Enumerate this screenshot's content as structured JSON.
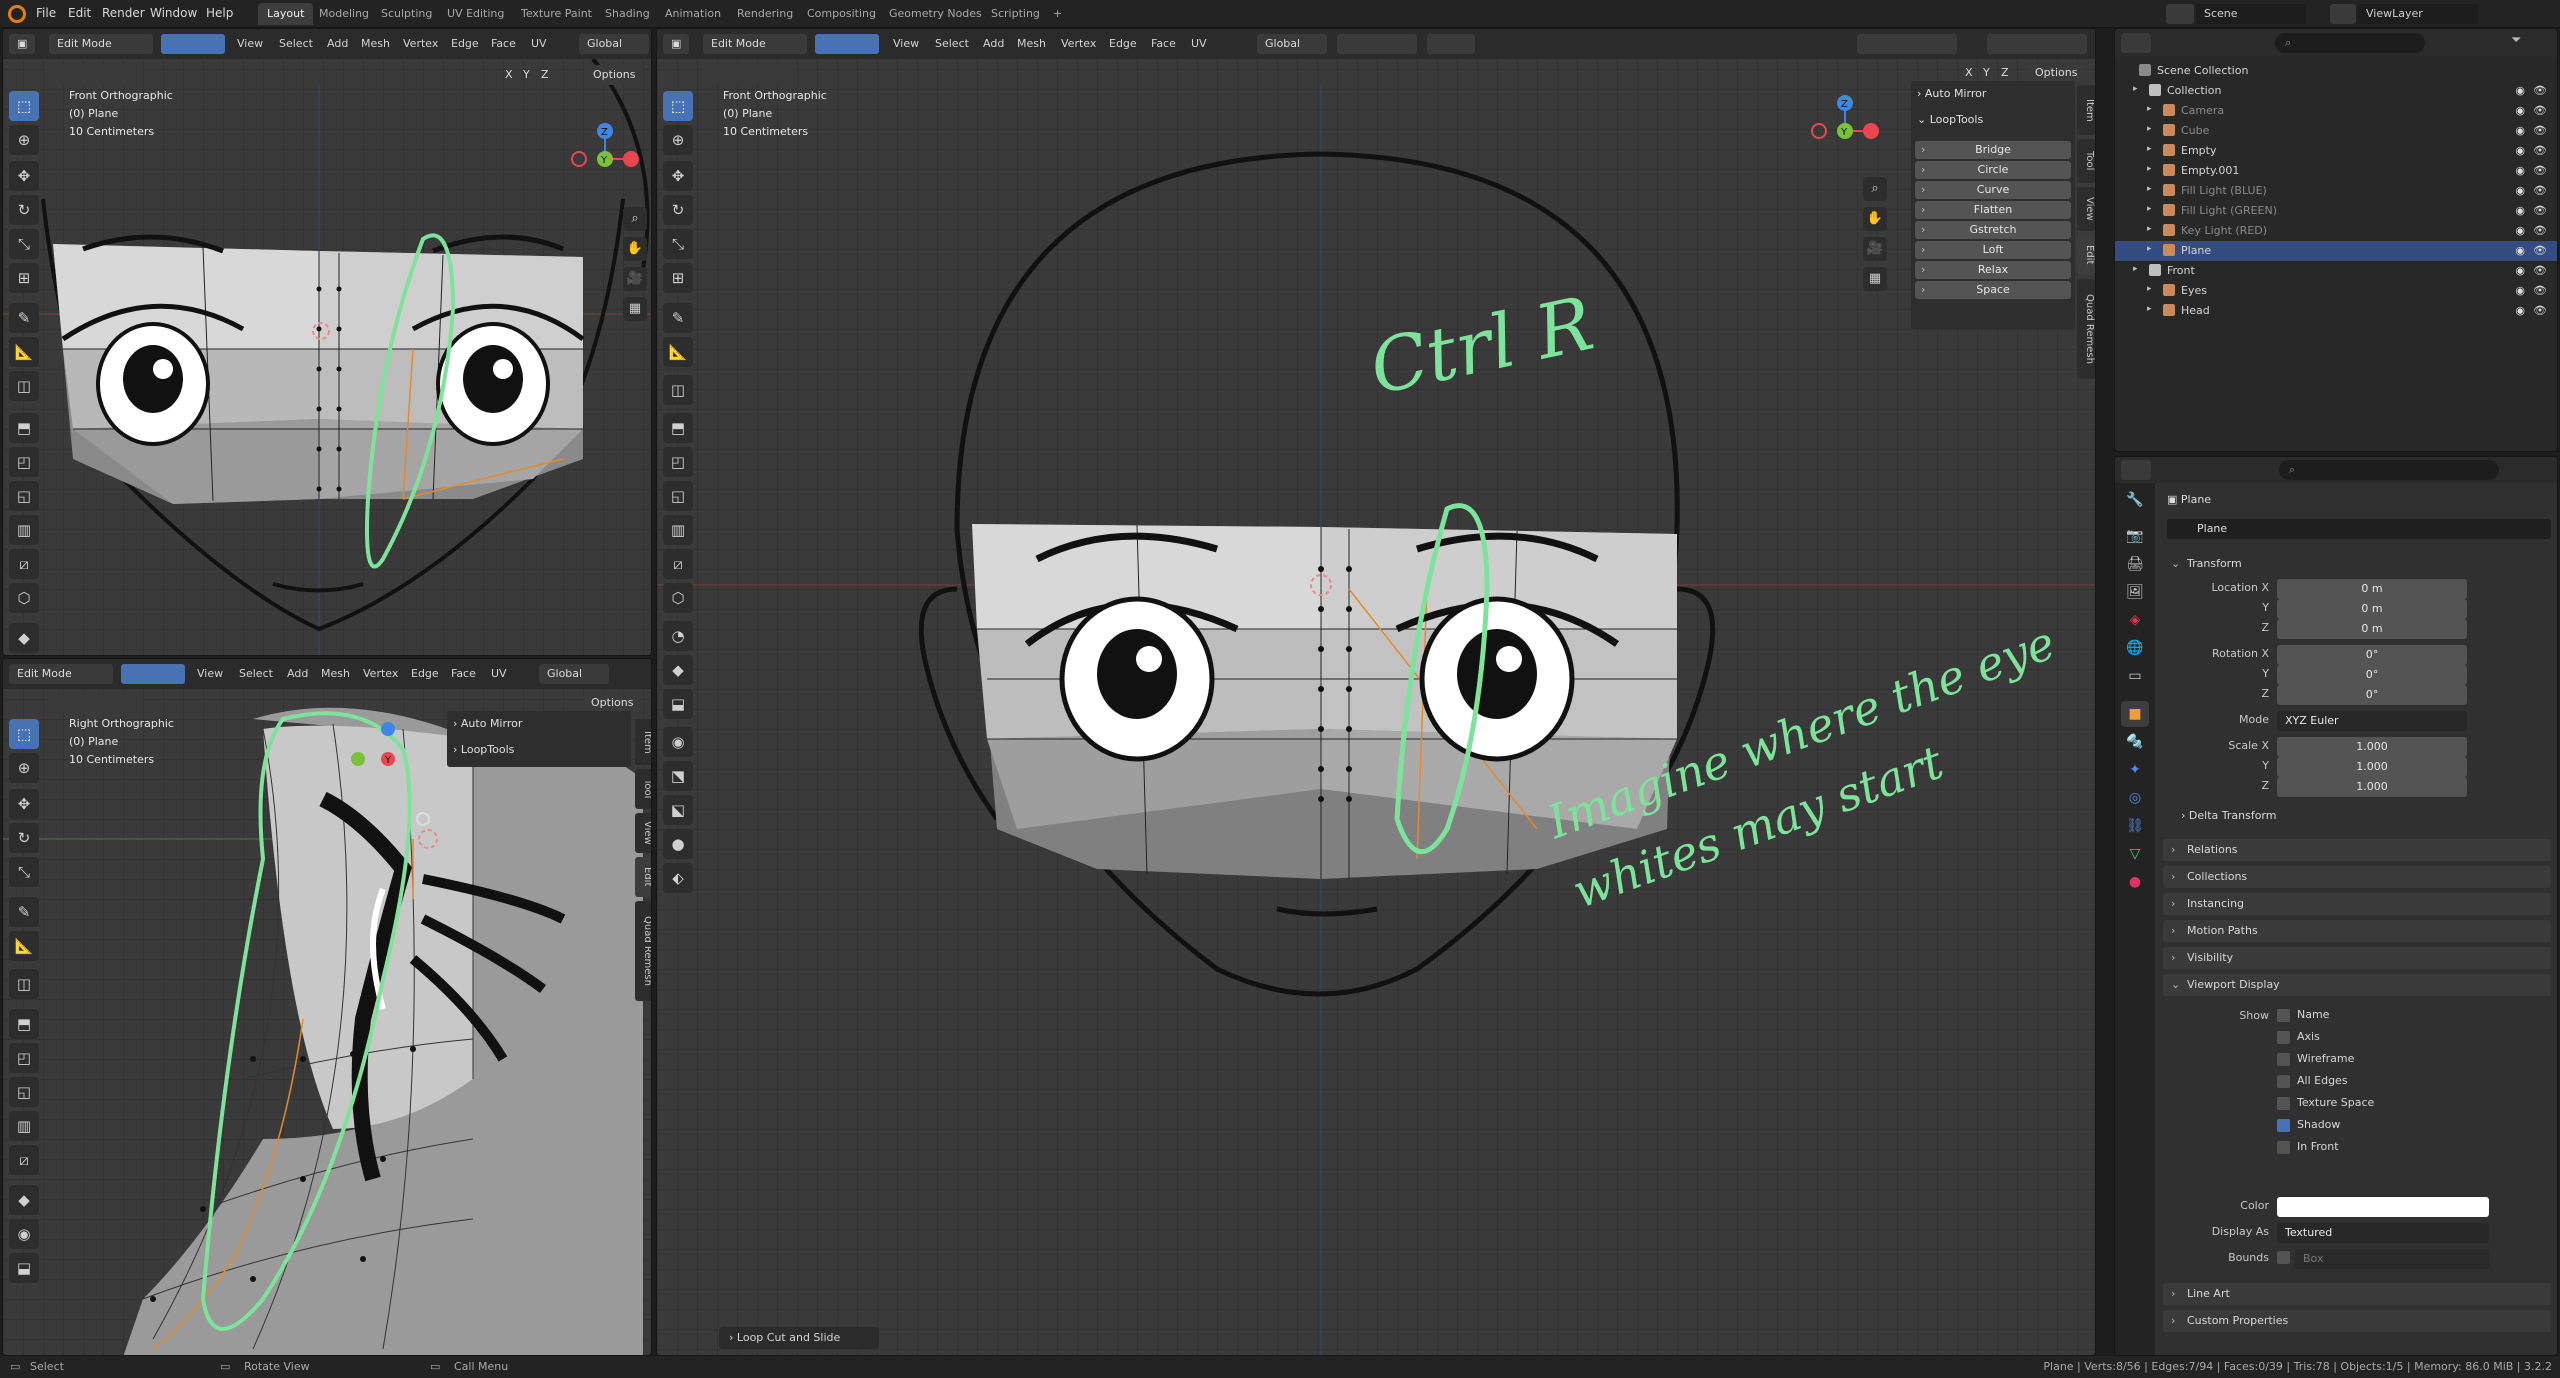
{
  "menu": [
    "File",
    "Edit",
    "Render",
    "Window",
    "Help"
  ],
  "workspaces": {
    "active": "Layout",
    "tabs": [
      "Layout",
      "Modeling",
      "Sculpting",
      "UV Editing",
      "Texture Paint",
      "Shading",
      "Animation",
      "Rendering",
      "Compositing",
      "Geometry Nodes",
      "Scripting"
    ],
    "add": "+"
  },
  "top_right": {
    "scene": "Scene",
    "view_layer": "ViewLayer"
  },
  "vp_header": {
    "mode": "Edit Mode",
    "view": "View",
    "select": "Select",
    "add": "Add",
    "mesh": "Mesh",
    "vertex": "Vertex",
    "edge": "Edge",
    "face": "Face",
    "uv": "UV",
    "orientation": "Global",
    "options": "Options",
    "axes": [
      "X",
      "Y",
      "Z"
    ]
  },
  "viewport_tl": {
    "title": "Front Orthographic",
    "object": "(0) Plane",
    "scale": "10 Centimeters"
  },
  "viewport_bl": {
    "title": "Right Orthographic",
    "object": "(0) Plane",
    "scale": "10 Centimeters",
    "panel": {
      "auto_mirror": "Auto Mirror",
      "looptools": "LoopTools"
    }
  },
  "viewport_main": {
    "title": "Front Orthographic",
    "object": "(0) Plane",
    "scale": "10 Centimeters",
    "last_op": "Loop Cut and Slide"
  },
  "npanel_main": {
    "auto_mirror": "Auto Mirror",
    "looptools": "LoopTools",
    "buttons": [
      "Bridge",
      "Circle",
      "Curve",
      "Flatten",
      "Gstretch",
      "Loft",
      "Relax",
      "Space"
    ]
  },
  "side_tabs": [
    "Item",
    "Tool",
    "View",
    "Edit",
    "Quad Remesh"
  ],
  "gizmo": {
    "x": "X",
    "y": "Y",
    "z": "Z"
  },
  "handwriting": {
    "shortcut": "Ctrl R",
    "note": "Imagine where the eye whites may start"
  },
  "outliner": {
    "root": "Scene Collection",
    "rows": [
      {
        "label": "Collection",
        "depth": 1,
        "color": "#bfbfbf"
      },
      {
        "label": "Camera",
        "depth": 2,
        "color": "#c98a5e",
        "dim": true
      },
      {
        "label": "Cube",
        "depth": 2,
        "color": "#c98a5e",
        "dim": true
      },
      {
        "label": "Empty",
        "depth": 2,
        "color": "#c98a5e"
      },
      {
        "label": "Empty.001",
        "depth": 2,
        "color": "#c98a5e"
      },
      {
        "label": "Fill Light (BLUE)",
        "depth": 2,
        "color": "#c98a5e",
        "dim": true
      },
      {
        "label": "Fill Light (GREEN)",
        "depth": 2,
        "color": "#c98a5e",
        "dim": true
      },
      {
        "label": "Key Light (RED)",
        "depth": 2,
        "color": "#c98a5e",
        "dim": true
      },
      {
        "label": "Plane",
        "depth": 2,
        "color": "#c98a5e",
        "selected": true
      },
      {
        "label": "Front",
        "depth": 1,
        "color": "#bfbfbf"
      },
      {
        "label": "Eyes",
        "depth": 2,
        "color": "#c98a5e"
      },
      {
        "label": "Head",
        "depth": 2,
        "color": "#c98a5e"
      }
    ]
  },
  "properties": {
    "object_name": "Plane",
    "data_name": "Plane",
    "transform": "Transform",
    "location_label": "Location X",
    "location": [
      "0 m",
      "0 m",
      "0 m"
    ],
    "rotation_label": "Rotation X",
    "rotation": [
      "0°",
      "0°",
      "0°"
    ],
    "mode_label": "Mode",
    "mode": "XYZ Euler",
    "scale_label": "Scale X",
    "scale": [
      "1.000",
      "1.000",
      "1.000"
    ],
    "axis_y": "Y",
    "axis_z": "Z",
    "delta": "Delta Transform",
    "sections": [
      "Relations",
      "Collections",
      "Instancing",
      "Motion Paths",
      "Visibility"
    ],
    "viewport_display": "Viewport Display",
    "show_label": "Show",
    "show_items": [
      {
        "label": "Name",
        "on": false
      },
      {
        "label": "Axis",
        "on": false
      },
      {
        "label": "Wireframe",
        "on": false
      },
      {
        "label": "All Edges",
        "on": false
      },
      {
        "label": "Texture Space",
        "on": false
      },
      {
        "label": "Shadow",
        "on": true
      },
      {
        "label": "In Front",
        "on": false
      }
    ],
    "color_label": "Color",
    "color": "#ffffff",
    "display_as_label": "Display As",
    "display_as": "Textured",
    "bounds_label": "Bounds",
    "bounds": "Box",
    "bottom_sections": [
      "Line Art",
      "Custom Properties"
    ]
  },
  "status": {
    "select": "Select",
    "rotate": "Rotate View",
    "menu": "Call Menu",
    "stats": "Plane | Verts:8/56 | Edges:7/94 | Faces:0/39 | Tris:78 | Objects:1/5 | Memory: 86.0 MiB | 3.2.2"
  },
  "colors": {
    "accent": "#4772b3",
    "annotation": "#7ee39a",
    "x_axis": "#e8474f",
    "y_axis": "#7bc23a",
    "z_axis": "#3f86e8"
  }
}
